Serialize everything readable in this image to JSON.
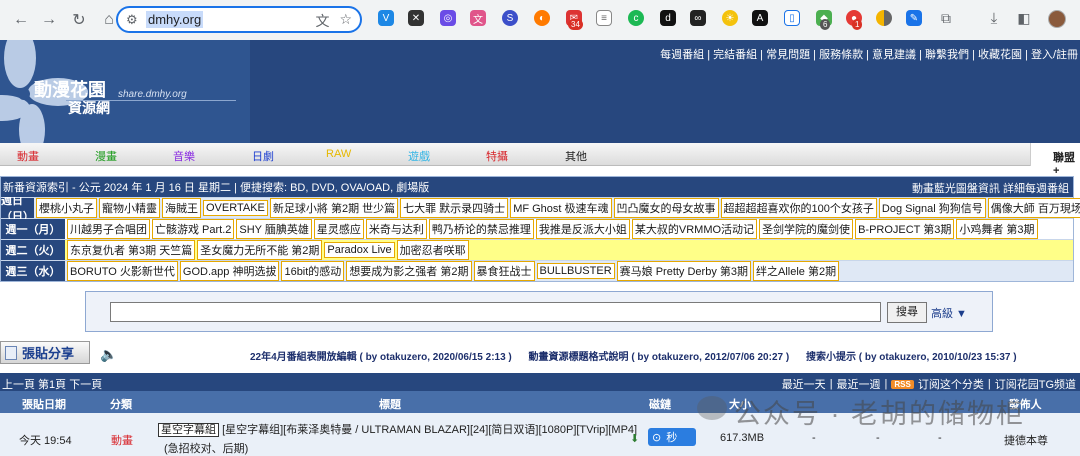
{
  "browser": {
    "url": "dmhy.org",
    "ext_badge_mail": "34",
    "ext_badge_a": "6",
    "ext_badge_b": "1"
  },
  "header": {
    "logo_title": "動漫花園",
    "logo_sub": "資源網",
    "logo_url": "share.dmhy.org",
    "top_links": "每週番組 | 完結番組 | 常見問題 | 服務條款 | 意見建議 | 聯繫我們 | 收藏花園 | 登入/註冊"
  },
  "categories": [
    {
      "label": "動畫",
      "color": "#d8262c"
    },
    {
      "label": "漫畫",
      "color": "#1a9a1a"
    },
    {
      "label": "音樂",
      "color": "#8a2be2"
    },
    {
      "label": "日劇",
      "color": "#1e3fd0"
    },
    {
      "label": "RAW",
      "color": "#e6b800"
    },
    {
      "label": "遊戲",
      "color": "#33b5e5"
    },
    {
      "label": "特攝",
      "color": "#d8262c"
    },
    {
      "label": "其他",
      "color": "#222222"
    }
  ],
  "union_label": "聯盟 +",
  "schedule": {
    "header_left": "新番資源索引 - 公元 2024 年 1 月 16 日 星期二 | 便捷搜索: BD, DVD, OVA/OAD, 劇場版",
    "header_right": "動畫藍光圖盤資訊 詳細每週番組",
    "rows": [
      {
        "day": "週日（日）",
        "bg": "#dfe8f5",
        "items": [
          "櫻桃小丸子",
          "寵物小精靈",
          "海賊王",
          "OVERTAKE",
          "新足球小將 第2期 世少篇",
          "七大罪 默示录四骑士",
          "MF Ghost 极速车魂",
          "凹凸魔女的母女故事",
          "超超超超喜欢你的100个女孩子",
          "Dog Signal 狗狗信号",
          "偶像大師 百万現场"
        ]
      },
      {
        "day": "週一（月）",
        "bg": "#ffffff",
        "items": [
          "川越男子合唱团",
          "亡骸游戏 Part.2",
          "SHY 腼腆英雄",
          "星灵感应",
          "米奇与达利",
          "鸭乃桥论的禁忌推理",
          "我推是反派大小姐",
          "某大叔的VRMMO活动记",
          "圣剑学院的魔剑使",
          "B-PROJECT 第3期",
          "小鸡舞者 第3期"
        ]
      },
      {
        "day": "週二（火）",
        "bg": "#ffff88",
        "items": [
          "东京复仇者 第3期 天竺篇",
          "圣女魔力无所不能 第2期",
          "Paradox Live",
          "加密忍者咲耶"
        ]
      },
      {
        "day": "週三（水）",
        "bg": "#dfe8f5",
        "items": [
          "BORUTO 火影新世代",
          "GOD.app 神明选拔",
          "16bit的感动",
          "想要成为影之强者 第2期",
          "暴食狂战士",
          "BULLBUSTER",
          "赛马娘 Pretty Derby 第3期",
          "绊之Allele 第2期"
        ]
      }
    ]
  },
  "search": {
    "button": "搜尋",
    "advanced": "高級 ▼",
    "value": ""
  },
  "post_button": "張貼分享",
  "notices": [
    "22年4月番組表開放編輯 ( by otakuzero, 2020/06/15 2:13 )",
    "動畫資源標題格式說明 ( by otakuzero, 2012/07/06 20:27 )",
    "搜索小提示 ( by otakuzero, 2010/10/23 15:37 )"
  ],
  "pager": {
    "left": "上一頁 第1頁 下一頁",
    "recent_day": "最近一天",
    "recent_week": "最近一週",
    "rss": "RSS",
    "subscribe": "订阅这个分类",
    "tg": "订阅花园TG频道"
  },
  "table": {
    "headers": [
      "張貼日期",
      "分類",
      "標題",
      "磁鏈",
      "大小",
      "",
      "",
      "",
      "發佈人"
    ],
    "row": {
      "date": "今天 19:54",
      "category": "動畫",
      "tag": "星空字幕組",
      "title": "[星空字幕组][布莱泽奥特曼 / ULTRAMAN BLAZAR][24][简日双语][1080P][TVrip][MP4]",
      "title2": "(急招校对、后期)",
      "play": "秒",
      "size": "617.3MB",
      "seed": "-",
      "dl": "-",
      "done": "-",
      "publisher": "捷德本尊"
    }
  },
  "watermark": "公众号 · 老胡的储物柜"
}
